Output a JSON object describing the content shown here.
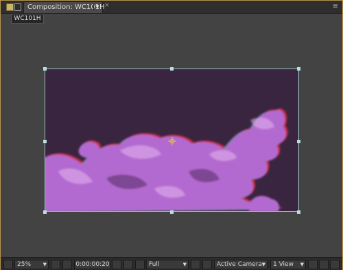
{
  "panel": {
    "tab_label": "Composition: WC101H",
    "tab_close": "×",
    "menu_icon": "≡",
    "breadcrumb": "WC101H"
  },
  "statusbar": {
    "zoom": "25%",
    "timecode": "0:00:00:20",
    "resolution": "Full",
    "camera": "Active Camera",
    "views": "1 View"
  },
  "colors": {
    "panel_border": "#b9924a",
    "comp_background": "#3a2540",
    "cloud_main": "#b36bd0",
    "cloud_edge_red": "#e0303f",
    "cloud_edge_cyan": "#5fa8b8",
    "bbox": "#9fc3c8"
  },
  "icons": [
    "lock-icon",
    "panel-icon",
    "dropdown-arrow-icon",
    "close-icon",
    "panel-menu-icon",
    "monitor-icon",
    "fit-icon",
    "region-of-interest-icon",
    "camera-icon",
    "person-icon",
    "color-channels-icon",
    "fast-preview-icon",
    "transparency-grid-icon",
    "layout-icon",
    "draft3d-icon",
    "flowchart-icon"
  ]
}
